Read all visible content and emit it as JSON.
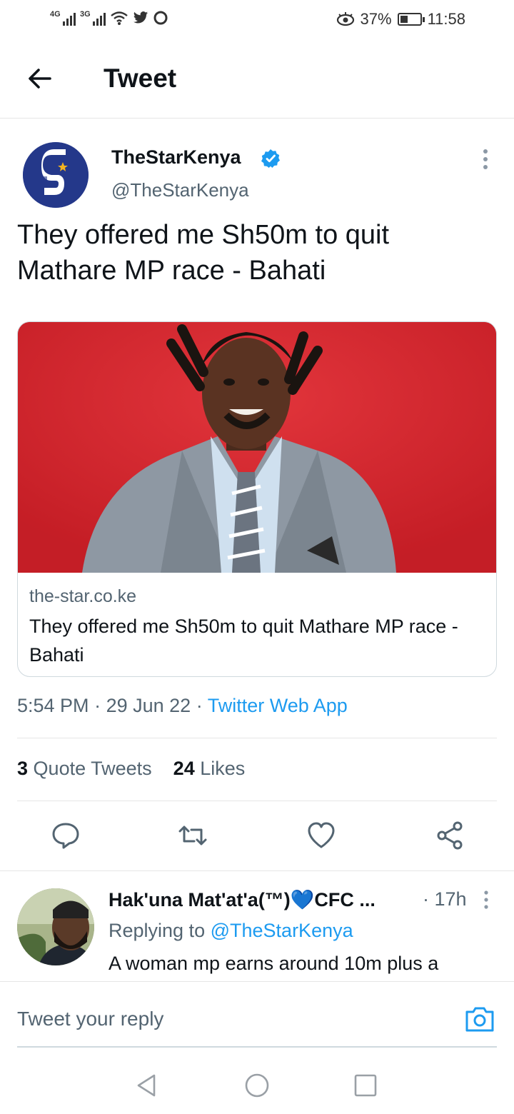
{
  "status_bar": {
    "network_1": "4G",
    "network_2": "3G",
    "battery_percent": "37%",
    "battery_level": 0.37,
    "time": "11:58"
  },
  "header": {
    "title": "Tweet",
    "back_icon": "arrow-left-icon"
  },
  "tweet": {
    "author_name": "TheStarKenya",
    "author_handle": "@TheStarKenya",
    "verified": true,
    "text": "They offered me Sh50m to quit Mathare MP race - Bahati",
    "card": {
      "domain": "the-star.co.ke",
      "title": "They offered me Sh50m to quit Mathare MP race - Bahati"
    },
    "meta": {
      "time": "5:54 PM",
      "date": "29 Jun 22",
      "source": "Twitter Web App"
    },
    "stats": {
      "quote_count": "3",
      "quote_label": "Quote Tweets",
      "like_count": "24",
      "like_label": "Likes"
    }
  },
  "actions": [
    "reply-icon",
    "retweet-icon",
    "like-icon",
    "share-icon"
  ],
  "reply": {
    "name": "Hak'una Mat'at'a(™)💙CFC ...",
    "time": "· 17h",
    "replying_prefix": "Replying to",
    "replying_handle": "@TheStarKenya",
    "text": "A woman mp earns around 10m plus a"
  },
  "composer": {
    "placeholder": "Tweet your reply",
    "camera_icon": "camera-icon"
  },
  "colors": {
    "accent": "#1d9bf0",
    "text": "#0f1419",
    "muted": "#536471"
  }
}
